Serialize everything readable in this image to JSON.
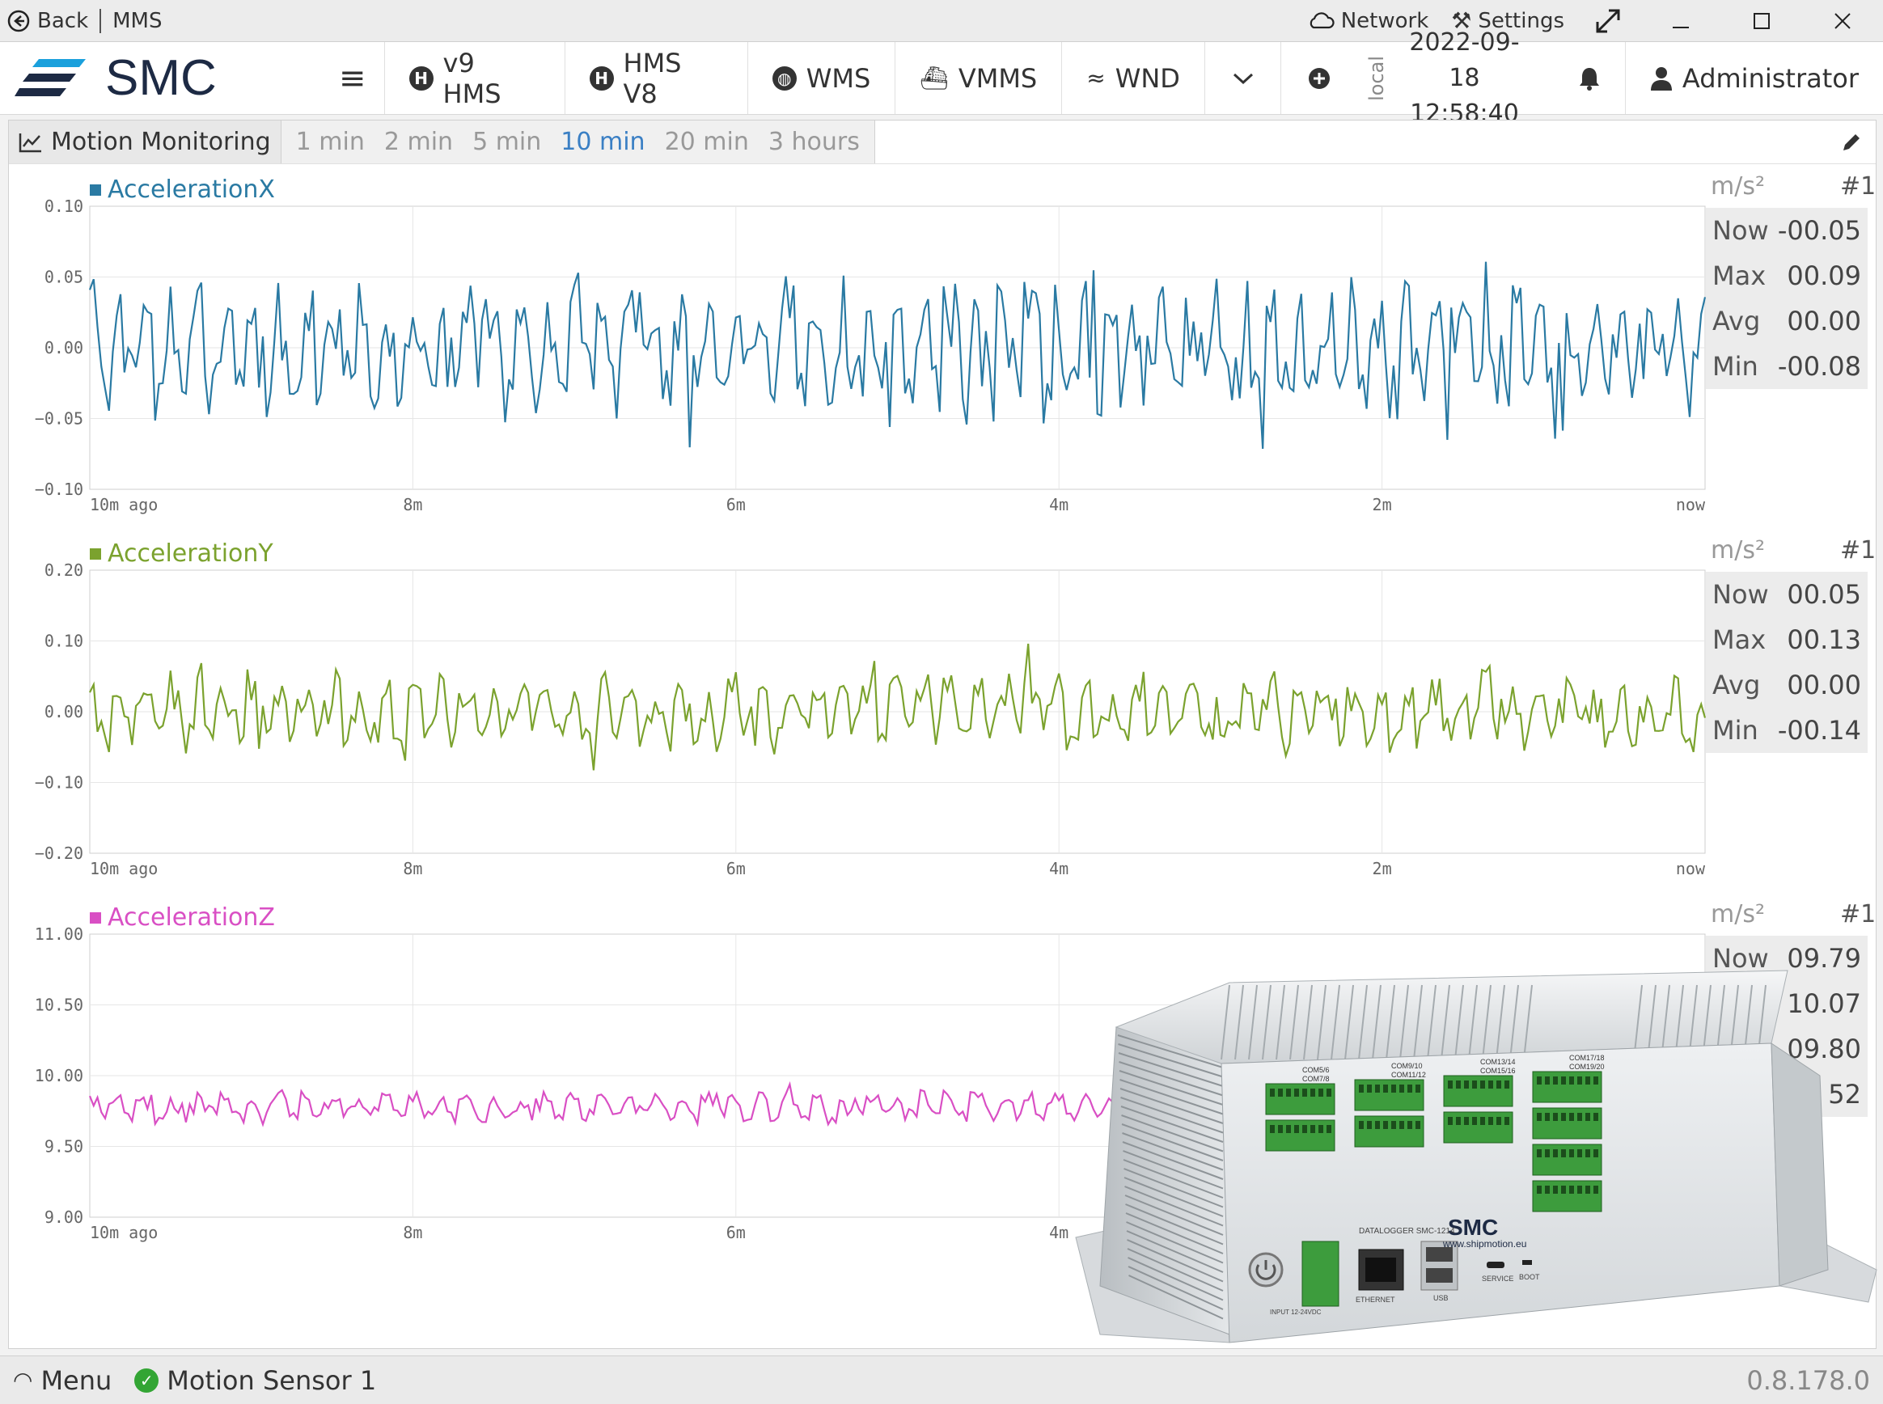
{
  "titlebar": {
    "back_label": "Back",
    "app_name": "MMS",
    "network_label": "Network",
    "settings_label": "Settings"
  },
  "nav": {
    "brand": "SMC",
    "tabs": [
      {
        "label": "v9 HMS",
        "icon": "h-circle-icon"
      },
      {
        "label": "HMS V8",
        "icon": "h-circle-icon"
      },
      {
        "label": "WMS",
        "icon": "globe-icon"
      },
      {
        "label": "VMMS",
        "icon": "ship-icon"
      },
      {
        "label": "WND",
        "icon": "wind-icon"
      }
    ],
    "clock_zone": "local",
    "date": "2022-09-18",
    "time": "12:58:40",
    "user": "Administrator"
  },
  "panel": {
    "title": "Motion Monitoring",
    "ranges": [
      "1 min",
      "2 min",
      "5 min",
      "10 min",
      "20 min",
      "3 hours"
    ],
    "active_range": "10 min"
  },
  "charts": [
    {
      "name": "AccelerationX",
      "color": "#2a7aa3",
      "unit": "m/s²",
      "index": "#1",
      "yticks": [
        "0.10",
        "0.05",
        "0.00",
        "−0.05",
        "−0.10"
      ],
      "xticks": [
        "10m ago",
        "8m",
        "6m",
        "4m",
        "2m",
        "now"
      ],
      "stats": {
        "now": "-00.05",
        "max": "00.09",
        "avg": "00.00",
        "min": "-00.08"
      }
    },
    {
      "name": "AccelerationY",
      "color": "#7ba22e",
      "unit": "m/s²",
      "index": "#1",
      "yticks": [
        "0.20",
        "0.10",
        "0.00",
        "−0.10",
        "−0.20"
      ],
      "xticks": [
        "10m ago",
        "8m",
        "6m",
        "4m",
        "2m",
        "now"
      ],
      "stats": {
        "now": "00.05",
        "max": "00.13",
        "avg": "00.00",
        "min": "-00.14"
      }
    },
    {
      "name": "AccelerationZ",
      "color": "#d94fc4",
      "unit": "m/s²",
      "index": "#1",
      "yticks": [
        "11.00",
        "10.50",
        "10.00",
        "9.50",
        "9.00"
      ],
      "xticks": [
        "10m ago",
        "8m",
        "6m",
        "4m"
      ],
      "stats": {
        "now": "09.79",
        "max": "10.07",
        "avg": "09.80",
        "min": "52"
      }
    }
  ],
  "stat_labels": {
    "now": "Now",
    "max": "Max",
    "avg": "Avg",
    "min": "Min"
  },
  "status": {
    "menu_label": "Menu",
    "sensor": "Motion Sensor 1",
    "version": "0.8.178.0"
  },
  "device": {
    "brand": "SMC",
    "url": "www.shipmotion.eu",
    "ports": [
      "COM5/6",
      "COM7/8",
      "COM9/10",
      "COM11/12",
      "COM13/14",
      "COM15/16",
      "COM17/18",
      "COM19/20"
    ],
    "labels": [
      "ETHERNET",
      "USB",
      "SERVICE",
      "BOOT",
      "INPUT 12-24VDC"
    ],
    "model": "DATALOGGER SMC-1214"
  }
}
